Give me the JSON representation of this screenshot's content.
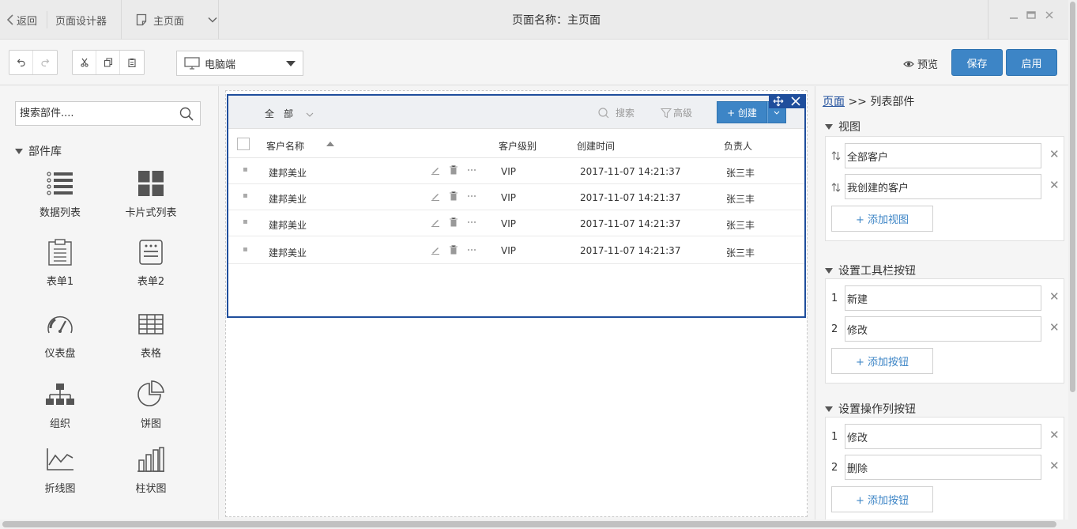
{
  "titlebar": {
    "back": "返回",
    "designer": "页面设计器",
    "page_select": "主页面",
    "page_name": "页面名称：主页面"
  },
  "toolbar": {
    "device": "电脑端",
    "preview": "预览",
    "save": "保存",
    "enable": "启用"
  },
  "left": {
    "search_placeholder": "搜索部件....",
    "library": "部件库",
    "components": [
      {
        "label": "数据列表",
        "icon": "list-icon"
      },
      {
        "label": "卡片式列表",
        "icon": "card-grid-icon"
      },
      {
        "label": "表单1",
        "icon": "clipboard-form-icon"
      },
      {
        "label": "表单2",
        "icon": "form-lines-icon"
      },
      {
        "label": "仪表盘",
        "icon": "gauge-icon"
      },
      {
        "label": "表格",
        "icon": "table-icon"
      },
      {
        "label": "组织",
        "icon": "org-chart-icon"
      },
      {
        "label": "饼图",
        "icon": "pie-chart-icon"
      },
      {
        "label": "折线图",
        "icon": "line-chart-icon"
      },
      {
        "label": "柱状图",
        "icon": "bar-chart-icon"
      }
    ]
  },
  "widget": {
    "filter": "全　部",
    "search": "搜索",
    "advanced": "高级",
    "create": "+ 创建",
    "columns": [
      "客户名称",
      "客户级别",
      "创建时间",
      "负责人"
    ],
    "rows": [
      {
        "name": "建邦美业",
        "level": "VIP",
        "time": "2017-11-07 14:21:37",
        "owner": "张三丰"
      },
      {
        "name": "建邦美业",
        "level": "VIP",
        "time": "2017-11-07 14:21:37",
        "owner": "张三丰"
      },
      {
        "name": "建邦美业",
        "level": "VIP",
        "time": "2017-11-07 14:21:37",
        "owner": "张三丰"
      },
      {
        "name": "建邦美业",
        "level": "VIP",
        "time": "2017-11-07 14:21:37",
        "owner": "张三丰"
      }
    ]
  },
  "right": {
    "breadcrumb_link": "页面",
    "breadcrumb_rest": " >> 列表部件",
    "views_title": "视图",
    "views": [
      "全部客户",
      "我创建的客户"
    ],
    "add_view": "+ 添加视图",
    "toolbar_title": "设置工具栏按钮",
    "toolbar_buttons": [
      {
        "num": "1",
        "label": "新建"
      },
      {
        "num": "2",
        "label": "修改"
      }
    ],
    "add_toolbar": "+ 添加按钮",
    "action_title": "设置操作列按钮",
    "action_buttons": [
      {
        "num": "1",
        "label": "修改"
      },
      {
        "num": "2",
        "label": "删除"
      }
    ],
    "add_action": "+ 添加按钮"
  },
  "colors": {
    "accent": "#3d85c6",
    "selection": "#1f4e9c",
    "link": "#1f4e9c"
  }
}
